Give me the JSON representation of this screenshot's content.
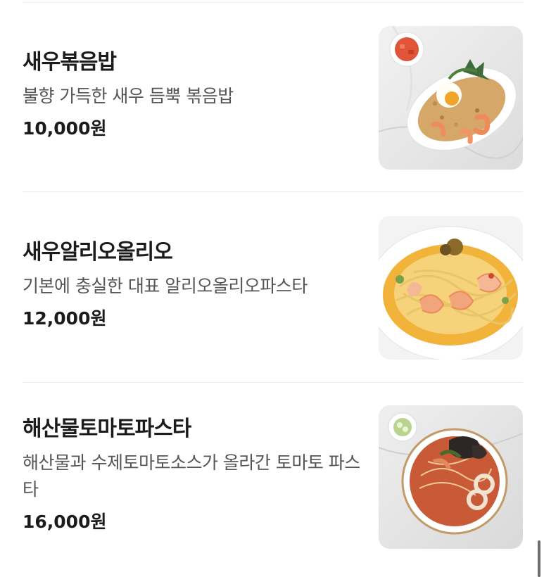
{
  "menu_items": [
    {
      "name": "새우볶음밥",
      "description": "불향 가득한 새우 듬뿍 볶음밥",
      "price": "10,000원",
      "image_icon": "shrimp-fried-rice-photo"
    },
    {
      "name": "새우알리오올리오",
      "description": "기본에 충실한 대표 알리오올리오파스타",
      "price": "12,000원",
      "image_icon": "shrimp-aglio-olio-photo"
    },
    {
      "name": "해산물토마토파스타",
      "description": "해산물과 수제토마토소스가 올라간 토마토 파스타",
      "price": "16,000원",
      "image_icon": "seafood-tomato-pasta-photo"
    }
  ]
}
